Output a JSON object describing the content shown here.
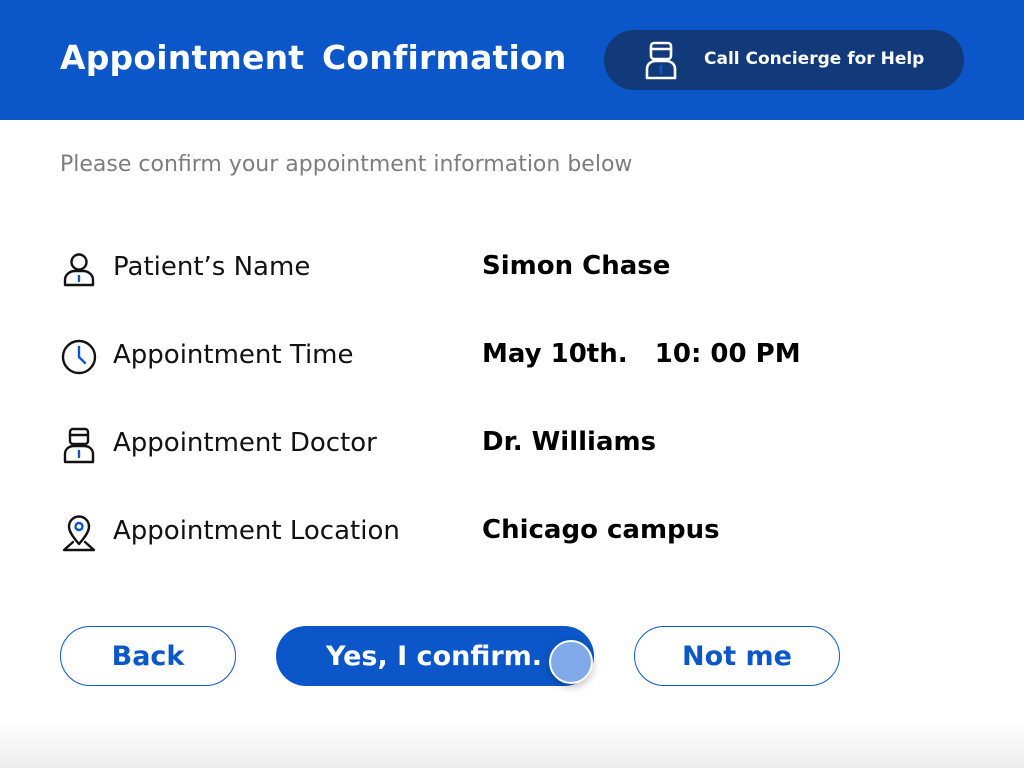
{
  "header": {
    "title": "Appointment  Confirmation",
    "help_button_label": "Call Concierge for Help",
    "help_button_icon": "doctor-icon",
    "background_color": "#0b57c9",
    "help_button_color": "#12397a"
  },
  "subtitle": "Please confirm your appointment information below",
  "details": [
    {
      "icon": "person-icon",
      "label": "Patient’s Name",
      "value": "Simon Chase"
    },
    {
      "icon": "clock-icon",
      "label": "Appointment Time",
      "value": "May 10th.   10: 00 PM"
    },
    {
      "icon": "doctor-icon",
      "label": "Appointment Doctor",
      "value": "Dr. Williams"
    },
    {
      "icon": "location-pin-icon",
      "label": "Appointment Location",
      "value": "Chicago campus"
    }
  ],
  "actions": {
    "back_label": "Back",
    "confirm_label": "Yes, I confirm.",
    "not_me_label": "Not me",
    "accent_color": "#0b57c9"
  }
}
